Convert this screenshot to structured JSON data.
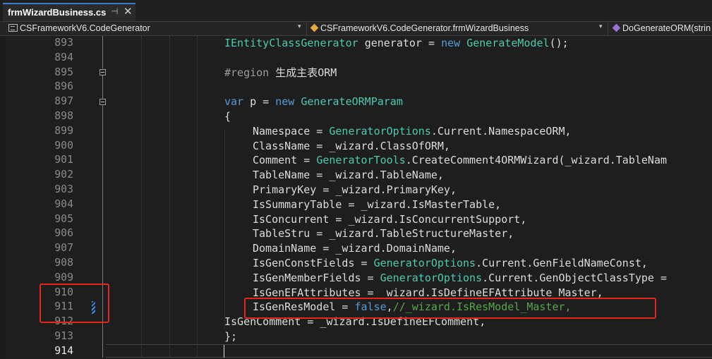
{
  "tab": {
    "title": "frmWizardBusiness.cs",
    "pin_glyph": "⊣",
    "close_glyph": "✕"
  },
  "navbar": {
    "project": "CSFrameworkV6.CodeGenerator",
    "class": "CSFrameworkV6.CodeGenerator.frmWizardBusiness",
    "member": "DoGenerateORM(strin",
    "caret_glyph": "▾",
    "icons": {
      "project": "project-icon",
      "class": "class-icon",
      "member": "method-icon"
    }
  },
  "editor": {
    "current_line": "914",
    "lines": [
      {
        "num": "893",
        "tokens": [
          [
            "IEntityClassGenerator",
            "type"
          ],
          [
            " ",
            "id"
          ],
          [
            "generator",
            "id"
          ],
          [
            " = ",
            "id"
          ],
          [
            "new",
            "kw"
          ],
          [
            " ",
            "id"
          ],
          [
            "GenerateModel",
            "type"
          ],
          [
            "();",
            "id"
          ]
        ]
      },
      {
        "num": "894",
        "tokens": []
      },
      {
        "num": "895",
        "tokens": [
          [
            "#region ",
            "pp"
          ],
          [
            "生成主表ORM",
            "id"
          ]
        ]
      },
      {
        "num": "896",
        "tokens": []
      },
      {
        "num": "897",
        "tokens": [
          [
            "var",
            "kw"
          ],
          [
            " p = ",
            "id"
          ],
          [
            "new",
            "kw"
          ],
          [
            " ",
            "id"
          ],
          [
            "GenerateORMParam",
            "type"
          ]
        ]
      },
      {
        "num": "898",
        "tokens": [
          [
            "{",
            "id"
          ]
        ]
      },
      {
        "num": "899",
        "tokens": [
          [
            "Namespace = ",
            "id"
          ],
          [
            "GeneratorOptions",
            "type"
          ],
          [
            ".Current.NamespaceORM,",
            "id"
          ]
        ]
      },
      {
        "num": "900",
        "tokens": [
          [
            "ClassName = _wizard.ClassOfORM,",
            "id"
          ]
        ]
      },
      {
        "num": "901",
        "tokens": [
          [
            "Comment = ",
            "id"
          ],
          [
            "GeneratorTools",
            "type"
          ],
          [
            ".CreateComment4ORMWizard(_wizard.TableNam",
            "id"
          ]
        ]
      },
      {
        "num": "902",
        "tokens": [
          [
            "TableName = _wizard.TableName,",
            "id"
          ]
        ]
      },
      {
        "num": "903",
        "tokens": [
          [
            "PrimaryKey = _wizard.PrimaryKey,",
            "id"
          ]
        ]
      },
      {
        "num": "904",
        "tokens": [
          [
            "IsSummaryTable = _wizard.IsMasterTable,",
            "id"
          ]
        ]
      },
      {
        "num": "905",
        "tokens": [
          [
            "IsConcurrent = _wizard.IsConcurrentSupport,",
            "id"
          ]
        ]
      },
      {
        "num": "906",
        "tokens": [
          [
            "TableStru = _wizard.TableStructureMaster,",
            "id"
          ]
        ]
      },
      {
        "num": "907",
        "tokens": [
          [
            "DomainName = _wizard.DomainName,",
            "id"
          ]
        ]
      },
      {
        "num": "908",
        "tokens": [
          [
            "IsGenConstFields = ",
            "id"
          ],
          [
            "GeneratorOptions",
            "type"
          ],
          [
            ".Current.GenFieldNameConst,",
            "id"
          ]
        ]
      },
      {
        "num": "909",
        "tokens": [
          [
            "IsGenMemberFields = ",
            "id"
          ],
          [
            "GeneratorOptions",
            "type"
          ],
          [
            ".Current.GenObjectClassType =",
            "id"
          ]
        ]
      },
      {
        "num": "910",
        "tokens": [
          [
            "IsGenEFAttributes = _wizard.IsDefineEFAttribute_Master,",
            "id"
          ]
        ]
      },
      {
        "num": "911",
        "tokens": [
          [
            "IsGenResModel = ",
            "id"
          ],
          [
            "false",
            "kw"
          ],
          [
            ",",
            "id"
          ],
          [
            "//_wizard.IsResModel_Master,",
            "cmt"
          ]
        ]
      },
      {
        "num": "912",
        "tokens": [
          [
            "IsGenComment = _wizard.IsDefineEFComment,",
            "id"
          ]
        ]
      },
      {
        "num": "913",
        "tokens": [
          [
            "};",
            "id"
          ]
        ]
      },
      {
        "num": "914",
        "tokens": []
      }
    ]
  }
}
